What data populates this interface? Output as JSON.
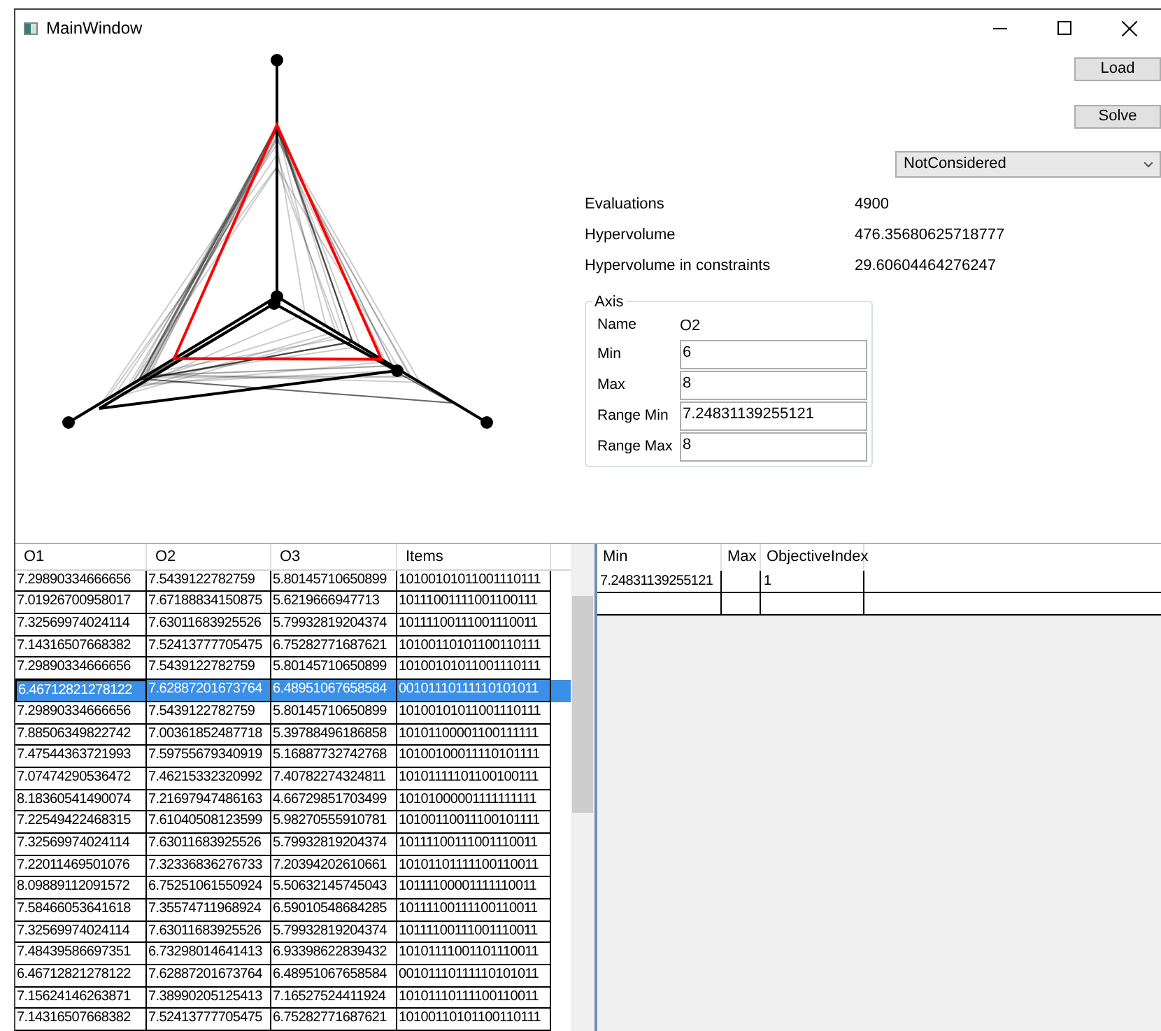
{
  "window": {
    "title": "MainWindow"
  },
  "buttons": [
    {
      "label": "Load"
    },
    {
      "label": "Solve"
    }
  ],
  "dropdown": {
    "value": "NotConsidered"
  },
  "stats": [
    {
      "label": "Evaluations",
      "value": "4900"
    },
    {
      "label": "Hypervolume",
      "value": "476.35680625718777"
    },
    {
      "label": "Hypervolume in constraints",
      "value": "29.60604464276247"
    }
  ],
  "axis": {
    "title": "Axis",
    "name_label": "Name",
    "name": "O2",
    "fields": [
      {
        "label": "Min",
        "value": "6"
      },
      {
        "label": "Max",
        "value": "8"
      },
      {
        "label": "Range Min",
        "value": "7.24831139255121"
      },
      {
        "label": "Range Max",
        "value": "8"
      }
    ]
  },
  "solutions": {
    "columns": [
      "O1",
      "O2",
      "O3",
      "Items"
    ],
    "rows": [
      {
        "cells": [
          "7.29890334666656",
          "7.5439122782759",
          "5.80145710650899",
          "10100101011001110111"
        ],
        "selected": false
      },
      {
        "cells": [
          "7.01926700958017",
          "7.67188834150875",
          "5.6219666947713",
          "10111001111001100111"
        ],
        "selected": false
      },
      {
        "cells": [
          "7.32569974024114",
          "7.63011683925526",
          "5.79932819204374",
          "10111100111001110011"
        ],
        "selected": false
      },
      {
        "cells": [
          "7.14316507668382",
          "7.52413777705475",
          "6.75282771687621",
          "10100110101100110111"
        ],
        "selected": false
      },
      {
        "cells": [
          "7.29890334666656",
          "7.5439122782759",
          "5.80145710650899",
          "10100101011001110111"
        ],
        "selected": false
      },
      {
        "cells": [
          "6.46712821278122",
          "7.62887201673764",
          "6.48951067658584",
          "00101110111110101011"
        ],
        "selected": true
      },
      {
        "cells": [
          "7.29890334666656",
          "7.5439122782759",
          "5.80145710650899",
          "10100101011001110111"
        ],
        "selected": false
      },
      {
        "cells": [
          "7.88506349822742",
          "7.00361852487718",
          "5.39788496186858",
          "10101100001100111111"
        ],
        "selected": false
      },
      {
        "cells": [
          "7.47544363721993",
          "7.59755679340919",
          "5.16887732742768",
          "10100100011110101111"
        ],
        "selected": false
      },
      {
        "cells": [
          "7.07474290536472",
          "7.46215332320992",
          "7.40782274324811",
          "10101111101100100111"
        ],
        "selected": false
      },
      {
        "cells": [
          "8.18360541490074",
          "7.21697947486163",
          "4.66729851703499",
          "10101000001111111111"
        ],
        "selected": false
      },
      {
        "cells": [
          "7.22549422468315",
          "7.61040508123599",
          "5.98270555910781",
          "10100110011100101111"
        ],
        "selected": false
      },
      {
        "cells": [
          "7.32569974024114",
          "7.63011683925526",
          "5.79932819204374",
          "10111100111001110011"
        ],
        "selected": false
      },
      {
        "cells": [
          "7.22011469501076",
          "7.32336836276733",
          "7.20394202610661",
          "10101101111100110011"
        ],
        "selected": false
      },
      {
        "cells": [
          "8.09889112091572",
          "6.75251061550924",
          "5.50632145745043",
          "10111100001111110011"
        ],
        "selected": false
      },
      {
        "cells": [
          "7.58466053641618",
          "7.35574711968924",
          "6.59010548684285",
          "10111100111100110011"
        ],
        "selected": false
      },
      {
        "cells": [
          "7.32569974024114",
          "7.63011683925526",
          "5.79932819204374",
          "10111100111001110011"
        ],
        "selected": false
      },
      {
        "cells": [
          "7.48439586697351",
          "6.73298014641413",
          "6.93398622839432",
          "10101111001101110011"
        ],
        "selected": false
      },
      {
        "cells": [
          "6.46712821278122",
          "7.62887201673764",
          "6.48951067658584",
          "00101110111110101011"
        ],
        "selected": false
      },
      {
        "cells": [
          "7.15624146263871",
          "7.38990205125413",
          "7.16527524411924",
          "10101110111100110011"
        ],
        "selected": false
      },
      {
        "cells": [
          "7.14316507668382",
          "7.52413777705475",
          "6.75282771687621",
          "10100110101100110111"
        ],
        "selected": false
      }
    ]
  },
  "constraints": {
    "columns": [
      "Min",
      "Max",
      "ObjectiveIndex"
    ],
    "rows": [
      {
        "cells": [
          "7.24831139255121",
          "",
          "1"
        ]
      }
    ]
  }
}
